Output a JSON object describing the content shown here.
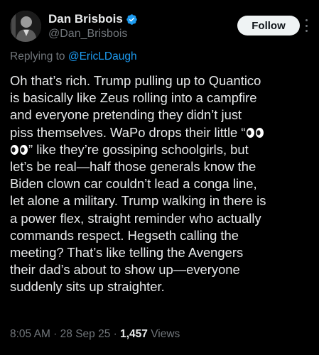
{
  "author": {
    "display_name": "Dan Brisbois",
    "handle": "@Dan_Brisbois",
    "verified": true
  },
  "actions": {
    "follow_label": "Follow"
  },
  "reply": {
    "prefix": "Replying to ",
    "mention": "@EricLDaugh"
  },
  "tweet": {
    "lines": [
      "Oh that’s rich. Trump pulling up to Quantico",
      "is basically like Zeus rolling into a campfire",
      "and everyone pretending they didn’t just",
      "piss themselves. WaPo drops their little “",
      "” like they’re gossiping schoolgirls, but",
      "let’s be real—half those generals know the",
      "Biden clown car couldn’t lead a conga line,",
      "let alone a military. Trump walking in there is",
      "a power flex, straight reminder who actually",
      "commands respect. Hegseth calling the",
      "meeting? That’s like telling the Avengers",
      "their dad’s about to show up—everyone",
      "suddenly sits up straighter."
    ]
  },
  "meta": {
    "time": "8:05 AM",
    "separator": " · ",
    "date": "28 Sep 25",
    "views_count": "1,457",
    "views_label": " Views"
  },
  "colors": {
    "background": "#000000",
    "text": "#e7e9ea",
    "secondary": "#71767b",
    "link": "#1d9bf0",
    "verified": "#1d9bf0",
    "follow_bg": "#eff3f4"
  },
  "icons": {
    "verified": "verified-badge-icon",
    "more": "more-options-icon",
    "eyes": "eyes-emoji-icon"
  }
}
